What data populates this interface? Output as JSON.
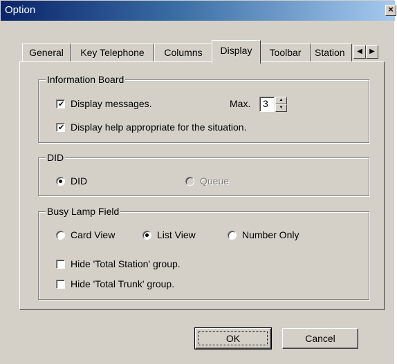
{
  "window": {
    "title": "Option",
    "close_label": "×"
  },
  "tabs": [
    {
      "label": "General"
    },
    {
      "label": "Key Telephone"
    },
    {
      "label": "Columns"
    },
    {
      "label": "Display",
      "active": true
    },
    {
      "label": "Toolbar"
    },
    {
      "label": "Station"
    }
  ],
  "tab_scroll": {
    "left": "◀",
    "right": "▶"
  },
  "information_board": {
    "title": "Information Board",
    "display_messages": {
      "label": "Display messages.",
      "checked": true
    },
    "max_label": "Max.",
    "max_value": "3",
    "display_help": {
      "label": "Display help appropriate for the situation.",
      "checked": true
    }
  },
  "did": {
    "title": "DID",
    "options": [
      {
        "label": "DID",
        "selected": true,
        "enabled": true
      },
      {
        "label": "Queue",
        "selected": false,
        "enabled": false
      }
    ]
  },
  "busy_lamp_field": {
    "title": "Busy Lamp Field",
    "options": [
      {
        "label": "Card View",
        "selected": false
      },
      {
        "label": "List View",
        "selected": true
      },
      {
        "label": "Number Only",
        "selected": false
      }
    ],
    "hide_total_station": {
      "label": "Hide 'Total Station' group.",
      "checked": false
    },
    "hide_total_trunk": {
      "label": "Hide 'Total Trunk' group.",
      "checked": false
    }
  },
  "buttons": {
    "ok": "OK",
    "cancel": "Cancel"
  },
  "spin": {
    "up": "▲",
    "down": "▼"
  },
  "check_glyph": "✔"
}
